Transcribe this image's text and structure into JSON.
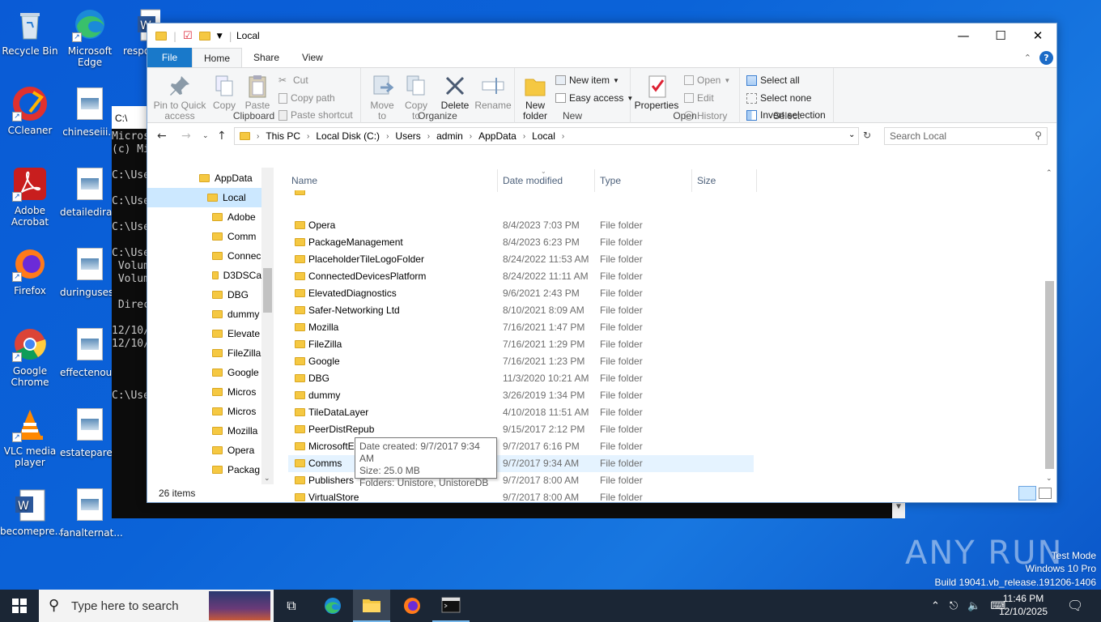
{
  "desktop": {
    "icons": [
      {
        "name": "recycle-bin-icon",
        "label": "Recycle Bin"
      },
      {
        "name": "edge-icon",
        "label": "Microsoft Edge"
      },
      {
        "name": "word-doc-icon",
        "label": "respo"
      },
      {
        "name": "ccleaner-icon",
        "label": "CCleaner"
      },
      {
        "name": "image-doc-icon",
        "label": "chineseiii..."
      },
      {
        "name": "acrobat-icon",
        "label": "Adobe Acrobat"
      },
      {
        "name": "image-doc-icon",
        "label": "detailedira..."
      },
      {
        "name": "firefox-icon",
        "label": "Firefox"
      },
      {
        "name": "image-doc-icon",
        "label": "duringuses..."
      },
      {
        "name": "chrome-icon",
        "label": "Google Chrome"
      },
      {
        "name": "image-doc-icon",
        "label": "effectenou..."
      },
      {
        "name": "vlc-icon",
        "label": "VLC media player"
      },
      {
        "name": "image-doc-icon",
        "label": "estateparen..."
      },
      {
        "name": "word-doc-icon",
        "label": "becomepre..."
      },
      {
        "name": "image-doc-icon",
        "label": "fanalternat..."
      }
    ]
  },
  "cmd": {
    "title": "C:\\",
    "lines": [
      "Micros",
      "(c) Mi",
      "",
      "C:\\Use",
      "",
      "C:\\Use",
      "",
      "C:\\Use",
      "",
      "C:\\Use",
      " Volum",
      " Volum",
      "",
      " Direc",
      "",
      "12/10/",
      "12/10/",
      "",
      "",
      "",
      "C:\\Use"
    ]
  },
  "explorer": {
    "title": "Local",
    "tabs": {
      "file": "File",
      "home": "Home",
      "share": "Share",
      "view": "View"
    },
    "ribbon": {
      "clipboard": {
        "label": "Clipboard",
        "pin": "Pin to Quick access",
        "copy": "Copy",
        "paste": "Paste",
        "cut": "Cut",
        "copy_path": "Copy path",
        "paste_shortcut": "Paste shortcut"
      },
      "organize": {
        "label": "Organize",
        "move_to": "Move to",
        "copy_to": "Copy to",
        "delete": "Delete",
        "rename": "Rename"
      },
      "new": {
        "label": "New",
        "new_folder": "New folder",
        "new_item": "New item",
        "easy_access": "Easy access"
      },
      "open": {
        "label": "Open",
        "properties": "Properties",
        "open": "Open",
        "edit": "Edit",
        "history": "History"
      },
      "select": {
        "label": "Select",
        "select_all": "Select all",
        "select_none": "Select none",
        "invert": "Invert selection"
      }
    },
    "breadcrumb": [
      "This PC",
      "Local Disk (C:)",
      "Users",
      "admin",
      "AppData",
      "Local"
    ],
    "search_placeholder": "Search Local",
    "nav": [
      "AppData",
      "Local",
      "Adobe",
      "Comm",
      "Connec",
      "D3DSCa",
      "DBG",
      "dummy",
      "Elevate",
      "FileZilla",
      "Google",
      "Micros",
      "Micros",
      "Mozilla",
      "Opera",
      "Packag"
    ],
    "columns": {
      "name": "Name",
      "date": "Date modified",
      "type": "Type",
      "size": "Size"
    },
    "rows": [
      {
        "name": "Opera",
        "date": "8/4/2023 7:03 PM",
        "type": "File folder"
      },
      {
        "name": "PackageManagement",
        "date": "8/4/2023 6:23 PM",
        "type": "File folder"
      },
      {
        "name": "PlaceholderTileLogoFolder",
        "date": "8/24/2022 11:53 AM",
        "type": "File folder"
      },
      {
        "name": "ConnectedDevicesPlatform",
        "date": "8/24/2022 11:11 AM",
        "type": "File folder"
      },
      {
        "name": "ElevatedDiagnostics",
        "date": "9/6/2021 2:43 PM",
        "type": "File folder"
      },
      {
        "name": "Safer-Networking Ltd",
        "date": "8/10/2021 8:09 AM",
        "type": "File folder"
      },
      {
        "name": "Mozilla",
        "date": "7/16/2021 1:47 PM",
        "type": "File folder"
      },
      {
        "name": "FileZilla",
        "date": "7/16/2021 1:29 PM",
        "type": "File folder"
      },
      {
        "name": "Google",
        "date": "7/16/2021 1:23 PM",
        "type": "File folder"
      },
      {
        "name": "DBG",
        "date": "11/3/2020 10:21 AM",
        "type": "File folder"
      },
      {
        "name": "dummy",
        "date": "3/26/2019 1:34 PM",
        "type": "File folder"
      },
      {
        "name": "TileDataLayer",
        "date": "4/10/2018 11:51 AM",
        "type": "File folder"
      },
      {
        "name": "PeerDistRepub",
        "date": "9/15/2017 2:12 PM",
        "type": "File folder"
      },
      {
        "name": "MicrosoftEdge",
        "date": "9/7/2017 6:16 PM",
        "type": "File folder"
      },
      {
        "name": "Comms",
        "date": "9/7/2017 9:34 AM",
        "type": "File folder"
      },
      {
        "name": "Publishers",
        "date": "9/7/2017 8:00 AM",
        "type": "File folder"
      },
      {
        "name": "VirtualStore",
        "date": "9/7/2017 8:00 AM",
        "type": "File folder"
      }
    ],
    "hovered_row": "Comms",
    "tooltip": {
      "line1": "Date created: 9/7/2017 9:34 AM",
      "line2": "Size: 25.0 MB",
      "line3": "Folders: Unistore, UnistoreDB"
    },
    "status": "26 items"
  },
  "taskbar": {
    "search_placeholder": "Type here to search",
    "time": "11:46 PM",
    "date": "12/10/2025"
  },
  "watermark": {
    "mode": "Test Mode",
    "os": "Windows 10 Pro",
    "build": "Build 19041.vb_release.191206-1406",
    "anyrun": "ANY RUN"
  }
}
